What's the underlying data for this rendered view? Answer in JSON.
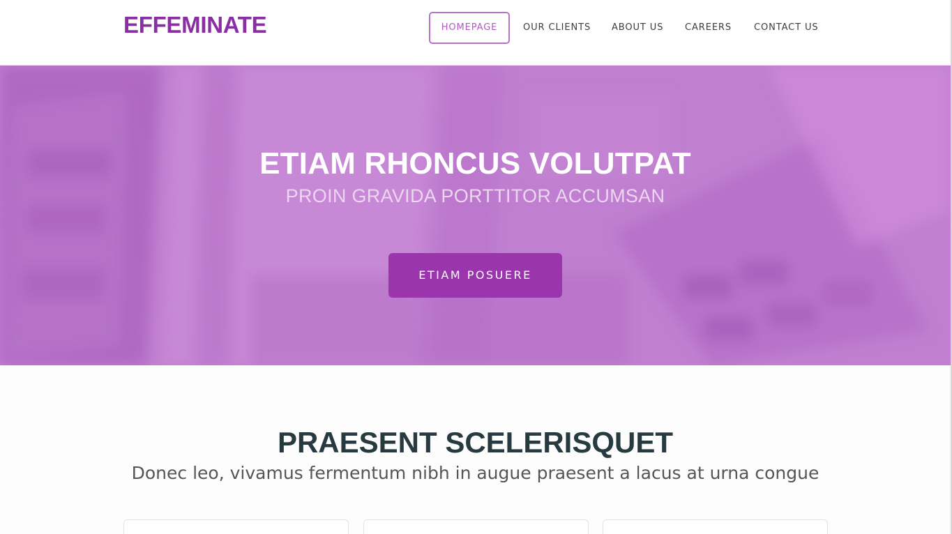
{
  "header": {
    "logo": "EFFEMINATE",
    "nav": [
      {
        "label": "HOMEPAGE",
        "active": true
      },
      {
        "label": "OUR CLIENTS",
        "active": false
      },
      {
        "label": "ABOUT US",
        "active": false
      },
      {
        "label": "CAREERS",
        "active": false
      },
      {
        "label": "CONTACT US",
        "active": false
      }
    ]
  },
  "hero": {
    "title": "ETIAM RHONCUS VOLUTPAT",
    "subtitle": "PROIN GRAVIDA PORTTITOR ACCUMSAN",
    "button_label": "ETIAM POSUERE"
  },
  "section": {
    "title": "PRAESENT SCELERISQUET",
    "subtitle": "Donec leo, vivamus fermentum nibh in augue praesent a lacus at urna congue"
  },
  "colors": {
    "brand": "#8a2fa3",
    "hero_overlay": "#c07fd0",
    "button": "#9b35ad",
    "active_nav_border": "#b672c9",
    "heading": "#263a40"
  }
}
